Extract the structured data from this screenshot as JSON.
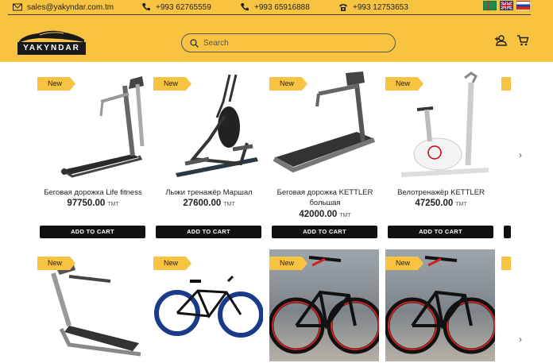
{
  "contacts": {
    "email": "sales@yakyndar.com.tm",
    "phone1": "+993 62765559",
    "phone2": "+993 65916888",
    "phone3": "+993 12753653"
  },
  "brand": {
    "logo_text": "YAKYNDAR"
  },
  "search": {
    "placeholder": "Search"
  },
  "products": [
    {
      "badge": "New",
      "title": "Беговая дорожка Life fitness",
      "price": "97750.00",
      "currency": "TMT",
      "cart": "ADD TO CART"
    },
    {
      "badge": "New",
      "title": "Лыжи тренажёр Маршал",
      "price": "27600.00",
      "currency": "TMT",
      "cart": "ADD TO CART"
    },
    {
      "badge": "New",
      "title": "Беговая дорожка KETTLER большая",
      "price": "42000.00",
      "currency": "TMT",
      "cart": "ADD TO CART"
    },
    {
      "badge": "New",
      "title": "Велотренажёр KETTLER",
      "price": "47250.00",
      "currency": "TMT",
      "cart": "ADD TO CART"
    },
    {
      "badge": "New"
    },
    {
      "badge": "New"
    },
    {
      "badge": "New"
    },
    {
      "badge": "New"
    }
  ]
}
